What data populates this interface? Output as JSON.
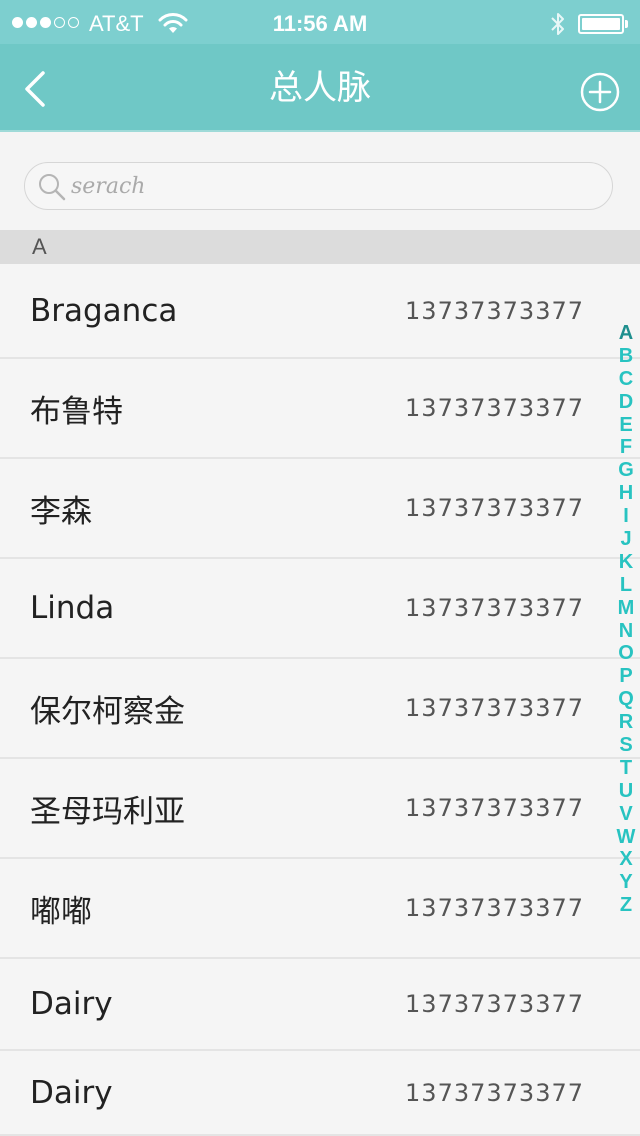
{
  "status_bar": {
    "carrier": "AT&T",
    "time": "11:56 AM",
    "signal_filled": 3,
    "signal_empty": 2
  },
  "nav": {
    "title": "总人脉",
    "back_icon": "chevron-left-icon",
    "add_icon": "circle-plus-icon"
  },
  "search": {
    "placeholder": "serach",
    "value": ""
  },
  "section": {
    "letter": "A"
  },
  "contacts": [
    {
      "name": "Braganca",
      "phone": "13737373377"
    },
    {
      "name": "布鲁特",
      "phone": "13737373377"
    },
    {
      "name": "李森",
      "phone": "13737373377"
    },
    {
      "name": "Linda",
      "phone": "13737373377"
    },
    {
      "name": "保尔柯察金",
      "phone": "13737373377"
    },
    {
      "name": "圣母玛利亚",
      "phone": "13737373377"
    },
    {
      "name": "嘟嘟",
      "phone": "13737373377"
    },
    {
      "name": "Dairy",
      "phone": "13737373377"
    },
    {
      "name": "Dairy",
      "phone": "13737373377"
    }
  ],
  "index_letters": [
    "A",
    "B",
    "C",
    "D",
    "E",
    "F",
    "G",
    "H",
    "I",
    "J",
    "K",
    "L",
    "M",
    "N",
    "O",
    "P",
    "Q",
    "R",
    "S",
    "T",
    "U",
    "V",
    "W",
    "X",
    "Y",
    "Z"
  ],
  "colors": {
    "status_bar": "#7dcfcf",
    "nav_bar": "#6fc8c6",
    "accent": "#28c3c1"
  }
}
